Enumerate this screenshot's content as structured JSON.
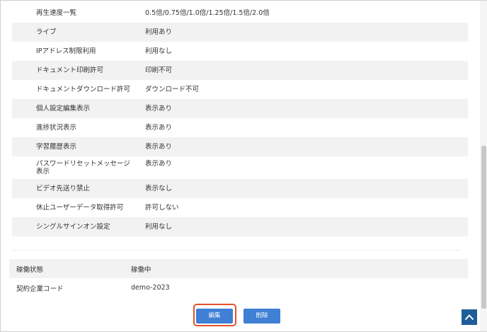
{
  "settings": [
    {
      "label": "再生速度一覧",
      "value": "0.5倍/0.75倍/1.0倍/1.25倍/1.5倍/2.0倍",
      "shaded": false
    },
    {
      "label": "ライブ",
      "value": "利用あり",
      "shaded": true
    },
    {
      "label": "IPアドレス制限利用",
      "value": "利用なし",
      "shaded": false
    },
    {
      "label": "ドキュメント印刷許可",
      "value": "印刷不可",
      "shaded": true
    },
    {
      "label": "ドキュメントダウンロード許可",
      "value": "ダウンロード不可",
      "shaded": false
    },
    {
      "label": "個人設定編集表示",
      "value": "表示あり",
      "shaded": true
    },
    {
      "label": "進捗状況表示",
      "value": "表示あり",
      "shaded": false
    },
    {
      "label": "学習履歴表示",
      "value": "表示あり",
      "shaded": true
    },
    {
      "label": "パスワードリセットメッセージ表示",
      "value": "表示あり",
      "shaded": false
    },
    {
      "label": "ビデオ先送り禁止",
      "value": "表示なし",
      "shaded": true
    },
    {
      "label": "休止ユーザーデータ取得許可",
      "value": "許可しない",
      "shaded": false
    },
    {
      "label": "シングルサインオン設定",
      "value": "利用なし",
      "shaded": true
    }
  ],
  "status": {
    "label": "稼働状態",
    "value": "稼働中"
  },
  "company_code": {
    "label": "契約企業コード",
    "value": "demo-2023"
  },
  "actions": {
    "edit_label": "編集",
    "delete_label": "削除"
  },
  "icons": {
    "back_to_top": "chevron-up-icon"
  }
}
